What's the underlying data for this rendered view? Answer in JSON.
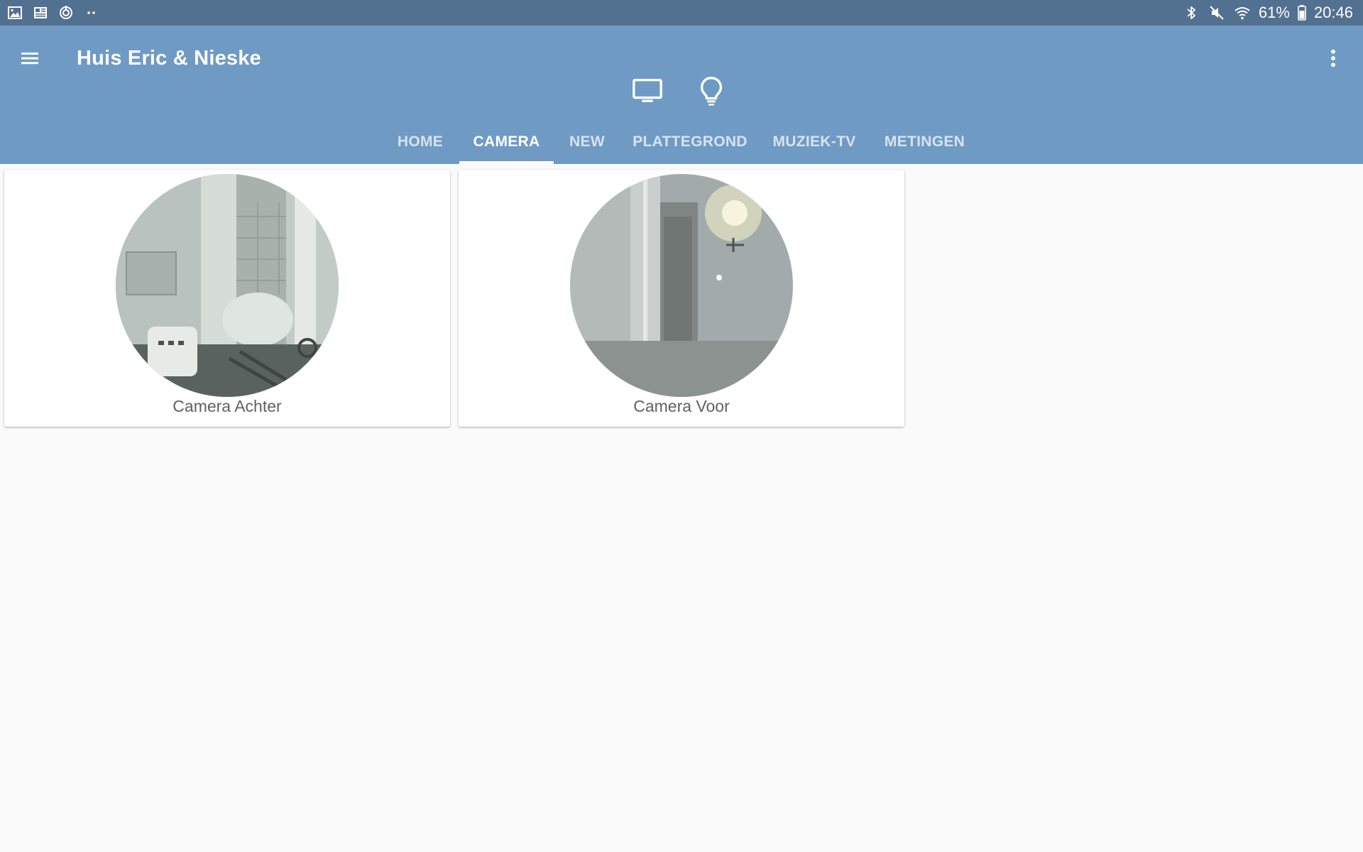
{
  "status_bar": {
    "left_icons": [
      "gallery-icon",
      "news-icon",
      "sync-icon",
      "more-dots-icon"
    ],
    "bluetooth": "bluetooth-icon",
    "sound": "mute-icon",
    "wifi": "wifi-icon",
    "battery_percent": "61%",
    "time": "20:46"
  },
  "app_bar": {
    "title": "Huis Eric & Nieske",
    "menu_icon": "hamburger-menu-icon",
    "overflow_icon": "more-vert-icon",
    "quick_icons": [
      "monitor-icon",
      "lightbulb-icon"
    ]
  },
  "tabs": [
    {
      "label": "HOME",
      "active": false
    },
    {
      "label": "CAMERA",
      "active": true
    },
    {
      "label": "NEW",
      "active": false
    },
    {
      "label": "PLATTEGROND",
      "active": false
    },
    {
      "label": "MUZIEK-TV",
      "active": false
    },
    {
      "label": "METINGEN",
      "active": false
    }
  ],
  "cameras": [
    {
      "label": "Camera Achter"
    },
    {
      "label": "Camera Voor"
    }
  ],
  "colors": {
    "status_bar": "#52708f",
    "app_bar": "#6f9ac4",
    "background": "#fafafa"
  }
}
